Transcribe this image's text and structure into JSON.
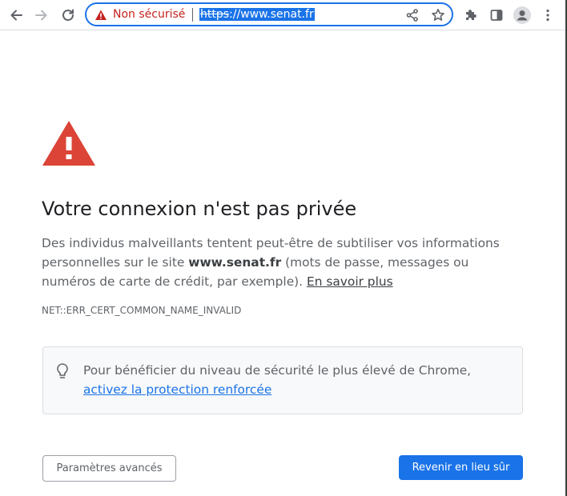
{
  "browser": {
    "security_label": "Non sécurisé",
    "url_scheme": "https",
    "url_rest": "://www.senat.fr",
    "icons": {
      "back": "arrow-left",
      "forward": "arrow-right",
      "reload": "reload",
      "warning": "warning-triangle",
      "share": "share",
      "bookmark": "star",
      "extensions": "puzzle-piece",
      "side_panel": "side-panel",
      "profile": "avatar",
      "menu": "three-dots"
    },
    "colors": {
      "accent": "#1a73e8",
      "danger": "#c5221f",
      "warning_red": "#db4437"
    }
  },
  "interstitial": {
    "heading": "Votre connexion n'est pas privée",
    "desc_before": "Des individus malveillants tentent peut-être de subtiliser vos informations personnelles sur le site ",
    "desc_domain": "www.senat.fr",
    "desc_after": " (mots de passe, messages ou numéros de carte de crédit, par exemple). ",
    "learn_more": "En savoir plus",
    "error_code": "NET::ERR_CERT_COMMON_NAME_INVALID",
    "callout_text": "Pour bénéficier du niveau de sécurité le plus élevé de Chrome, ",
    "callout_link": "activez la protection renforcée",
    "advanced_button": "Paramètres avancés",
    "back_button": "Revenir en lieu sûr"
  }
}
